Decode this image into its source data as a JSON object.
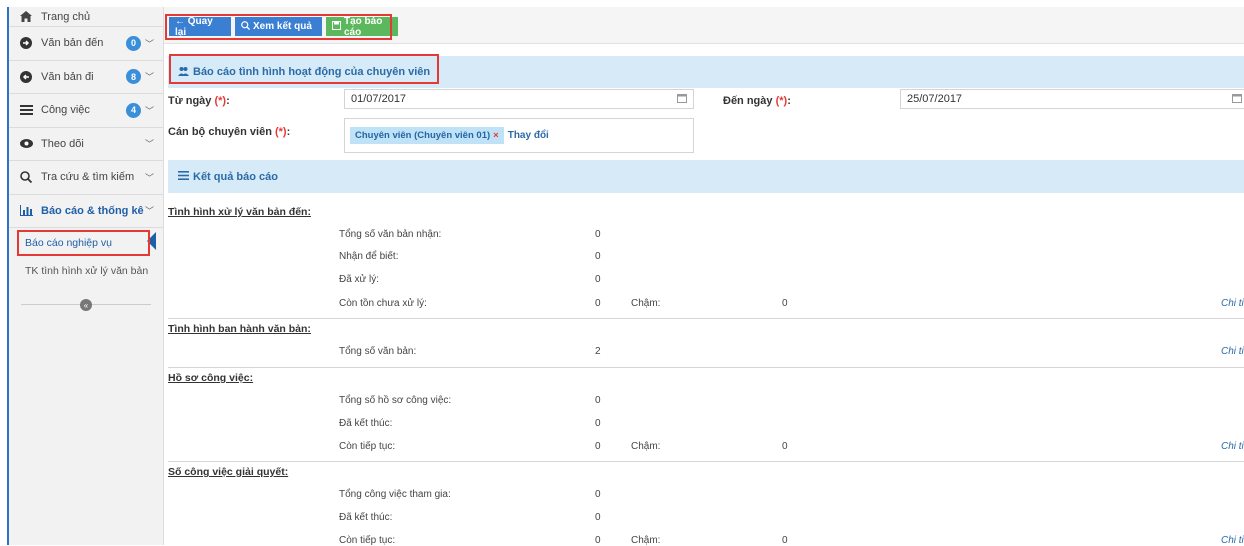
{
  "sidebar": {
    "items": [
      {
        "label": "Trang chủ",
        "icon": "home-icon"
      },
      {
        "label": "Văn bản đến",
        "icon": "arrow-circle-right-icon",
        "badge": "0"
      },
      {
        "label": "Văn bản đi",
        "icon": "arrow-circle-left-icon",
        "badge": "8"
      },
      {
        "label": "Công việc",
        "icon": "list-icon",
        "badge": "4"
      },
      {
        "label": "Theo dõi",
        "icon": "eye-icon"
      },
      {
        "label": "Tra cứu & tìm kiếm",
        "icon": "search-icon"
      },
      {
        "label": "Báo cáo & thống kê",
        "icon": "bar-chart-icon"
      }
    ],
    "subitems": [
      {
        "label": "Báo cáo nghiệp vụ"
      },
      {
        "label": "TK tình hình xử lý văn bản"
      }
    ],
    "collapse": "«"
  },
  "toolbar": {
    "back": "← Quay lại",
    "view": "Xem kết quả",
    "create": "Tạo báo cáo"
  },
  "panel": {
    "title": "Báo cáo tình hình hoạt động của chuyên viên",
    "from_label": "Từ ngày",
    "to_label": "Đến ngày",
    "req": "(*)",
    "colon": ":",
    "from_value": "01/07/2017",
    "to_value": "25/07/2017",
    "staff_label": "Cán bộ chuyên viên",
    "staff_value": "Chuyên viên (Chuyên viên 01)",
    "remove": "×",
    "change": "Thay đổi"
  },
  "results": {
    "title": "Kết quả báo cáo",
    "detail": "Chi ti",
    "sections": [
      {
        "title": "Tình hình xử lý văn bản đến:",
        "rows": [
          {
            "label": "Tổng số văn bản nhận:",
            "value": "0"
          },
          {
            "label": "Nhận để biết:",
            "value": "0"
          },
          {
            "label": "Đã xử lý:",
            "value": "0"
          },
          {
            "label": "Còn tồn chưa xử lý:",
            "value": "0",
            "cham": "Chậm:",
            "cham_value": "0"
          }
        ]
      },
      {
        "title": "Tình hình ban hành văn bản:",
        "rows": [
          {
            "label": "Tổng số văn bản:",
            "value": "2"
          }
        ]
      },
      {
        "title": "Hồ sơ công việc:",
        "rows": [
          {
            "label": "Tổng số hồ sơ công việc:",
            "value": "0"
          },
          {
            "label": "Đã kết thúc:",
            "value": "0"
          },
          {
            "label": "Còn tiếp tục:",
            "value": "0",
            "cham": "Chậm:",
            "cham_value": "0"
          }
        ]
      },
      {
        "title": "Số công việc giải quyết:",
        "rows": [
          {
            "label": "Tổng công việc tham gia:",
            "value": "0"
          },
          {
            "label": "Đã kết thúc:",
            "value": "0"
          },
          {
            "label": "Còn tiếp tục:",
            "value": "0",
            "cham": "Chậm:",
            "cham_value": "0"
          }
        ]
      }
    ]
  }
}
